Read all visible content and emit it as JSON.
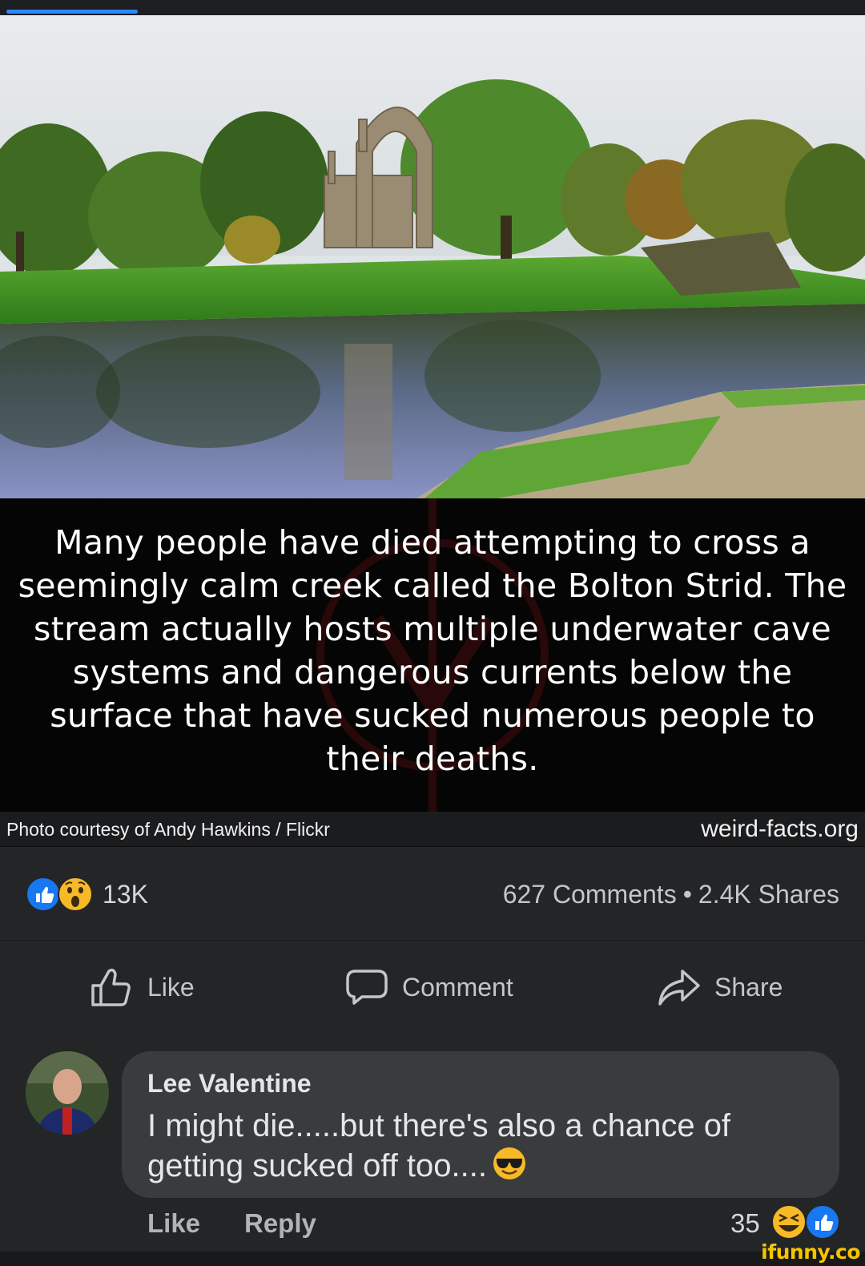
{
  "post": {
    "image_caption": "Many people have died attempting to cross a seemingly calm creek called the Bolton Strid. The stream actually hosts multiple underwater cave systems and dangerous currents below the surface that have sucked numerous people to their deaths.",
    "photo_credit": "Photo courtesy of Andy Hawkins / Flickr",
    "source_site": "weird-facts.org"
  },
  "reactions": {
    "icons": [
      "like-icon",
      "wow-icon"
    ],
    "count": "13K"
  },
  "stats": {
    "comments": "627 Comments",
    "separator": "•",
    "shares": "2.4K Shares"
  },
  "actions": {
    "like": "Like",
    "comment": "Comment",
    "share": "Share"
  },
  "comment": {
    "author": "Lee Valentine",
    "text": "I might die.....but there's also a chance of getting sucked off too....",
    "emoji": "sunglasses-face-icon",
    "like_label": "Like",
    "reply_label": "Reply",
    "reaction_count": "35",
    "reaction_icons": [
      "haha-icon",
      "like-icon"
    ]
  },
  "watermark": "ifunny.co",
  "colors": {
    "accent": "#2d88ff",
    "background": "#242526",
    "bubble": "#3a3b3c",
    "brand": "#f5c400"
  }
}
